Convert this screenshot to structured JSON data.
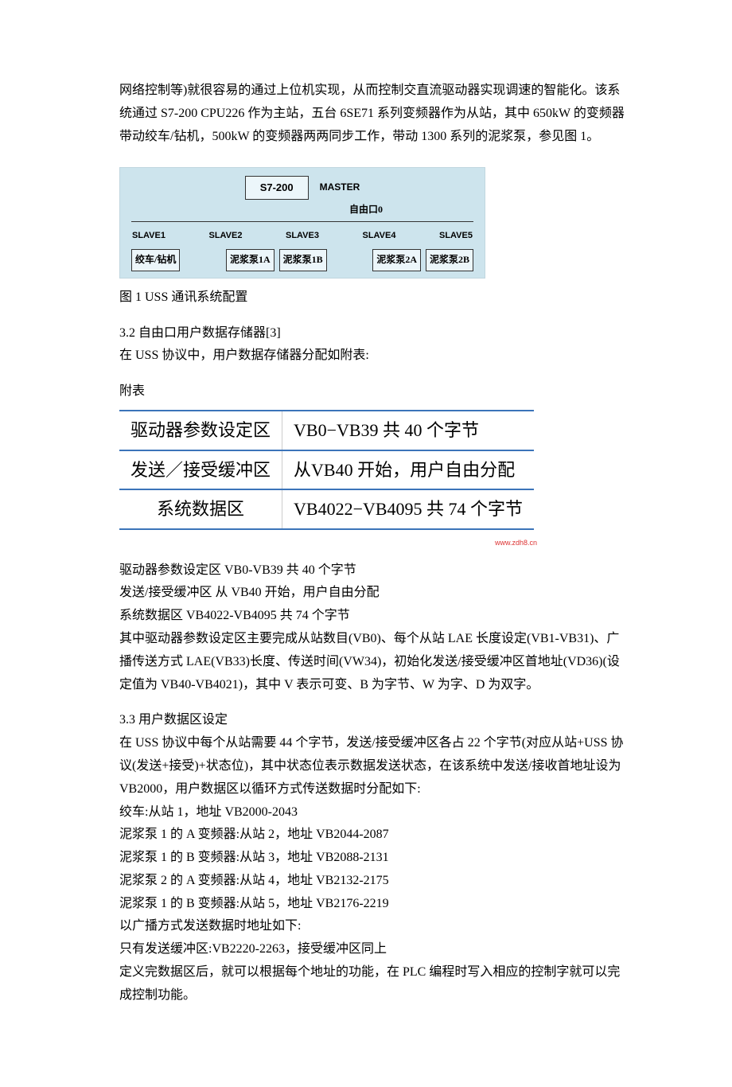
{
  "intro": {
    "p1": "网络控制等)就很容易的通过上位机实现，从而控制交直流驱动器实现调速的智能化。该系统通过 S7-200 CPU226 作为主站，五台 6SE71 系列变频器作为从站，其中 650kW 的变频器带动绞车/钻机，500kW 的变频器两两同步工作，带动 1300 系列的泥浆泵，参见图 1。"
  },
  "diagram": {
    "master_box": "S7-200",
    "master_label": "MASTER",
    "port_label": "自由口0",
    "slaves": [
      "SLAVE1",
      "SLAVE2",
      "SLAVE3",
      "SLAVE4",
      "SLAVE5"
    ],
    "leaves": [
      "绞车/钻机",
      "泥浆泵1A",
      "泥浆泵1B",
      "泥浆泵2A",
      "泥浆泵2B"
    ]
  },
  "fig1_caption": "图 1 USS 通讯系统配置",
  "sec32": {
    "title": "3.2  自由口用户数据存储器[3]",
    "line1": "在 USS 协议中，用户数据存储器分配如附表:",
    "table_label": "附表",
    "table": {
      "rows": [
        [
          "驱动器参数设定区",
          "VB0−VB39 共 40 个字节"
        ],
        [
          "发送／接受缓冲区",
          "从VB40 开始，用户自由分配"
        ],
        [
          "系统数据区",
          "VB4022−VB4095 共 74 个字节"
        ]
      ]
    },
    "watermark": "www.zdh8.cn",
    "after_table": [
      "驱动器参数设定区  VB0-VB39 共 40 个字节",
      "发送/接受缓冲区  从 VB40 开始，用户自由分配",
      "系统数据区  VB4022-VB4095 共 74 个字节",
      "其中驱动器参数设定区主要完成从站数目(VB0)、每个从站 LAE 长度设定(VB1-VB31)、广播传送方式 LAE(VB33)长度、传送时间(VW34)，初始化发送/接受缓冲区首地址(VD36)(设定值为 VB40-VB4021)，其中 V 表示可变、B 为字节、W 为字、D 为双字。"
    ]
  },
  "sec33": {
    "title": "3.3  用户数据区设定",
    "lines": [
      "在 USS 协议中每个从站需要 44 个字节，发送/接受缓冲区各占 22 个字节(对应从站+USS 协议(发送+接受)+状态位)，其中状态位表示数据发送状态，在该系统中发送/接收首地址设为VB2000，用户数据区以循环方式传送数据时分配如下:",
      "绞车:从站 1，地址  VB2000-2043",
      "泥浆泵 1 的 A 变频器:从站 2，地址  VB2044-2087",
      "泥浆泵 1 的 B 变频器:从站 3，地址  VB2088-2131",
      "泥浆泵 2 的 A 变频器:从站 4，地址  VB2132-2175",
      "泥浆泵 1 的 B 变频器:从站 5，地址  VB2176-2219",
      "以广播方式发送数据时地址如下:",
      "只有发送缓冲区:VB2220-2263，接受缓冲区同上",
      "定义完数据区后，就可以根据每个地址的功能，在 PLC 编程时写入相应的控制字就可以完成控制功能。"
    ]
  }
}
